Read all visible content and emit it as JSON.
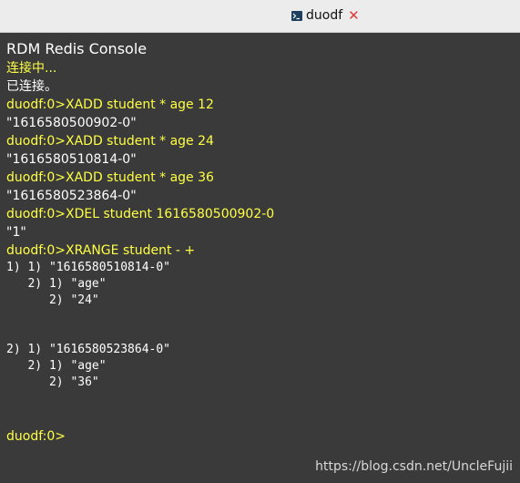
{
  "tab": {
    "title": "duodf",
    "icon": "terminal-icon",
    "close_icon": "close-icon"
  },
  "console": {
    "header": "RDM Redis Console",
    "status_connecting": "连接中...",
    "status_connected": "已连接。",
    "lines": [
      {
        "text": "duodf:0>XADD student * age 12",
        "color": "yellow"
      },
      {
        "text": "\"1616580500902-0\"",
        "color": "white"
      },
      {
        "text": "duodf:0>XADD student * age 24",
        "color": "yellow"
      },
      {
        "text": "\"1616580510814-0\"",
        "color": "white"
      },
      {
        "text": "duodf:0>XADD student * age 36",
        "color": "yellow"
      },
      {
        "text": "\"1616580523864-0\"",
        "color": "white"
      },
      {
        "text": "duodf:0>XDEL student 1616580500902-0",
        "color": "yellow"
      },
      {
        "text": "\"1\"",
        "color": "white"
      },
      {
        "text": "duodf:0>XRANGE student - +",
        "color": "yellow"
      }
    ],
    "xrange_output": [
      "1) 1) \"1616580510814-0\"",
      "   2) 1) \"age\"",
      "      2) \"24\"",
      "",
      "",
      "2) 1) \"1616580523864-0\"",
      "   2) 1) \"age\"",
      "      2) \"36\""
    ],
    "prompt": "duodf:0>"
  },
  "watermark": "https://blog.csdn.net/UncleFujii",
  "colors": {
    "background": "#3a3a3a",
    "command": "#ffff45",
    "output": "#ffffff",
    "close": "#e03a3a"
  }
}
